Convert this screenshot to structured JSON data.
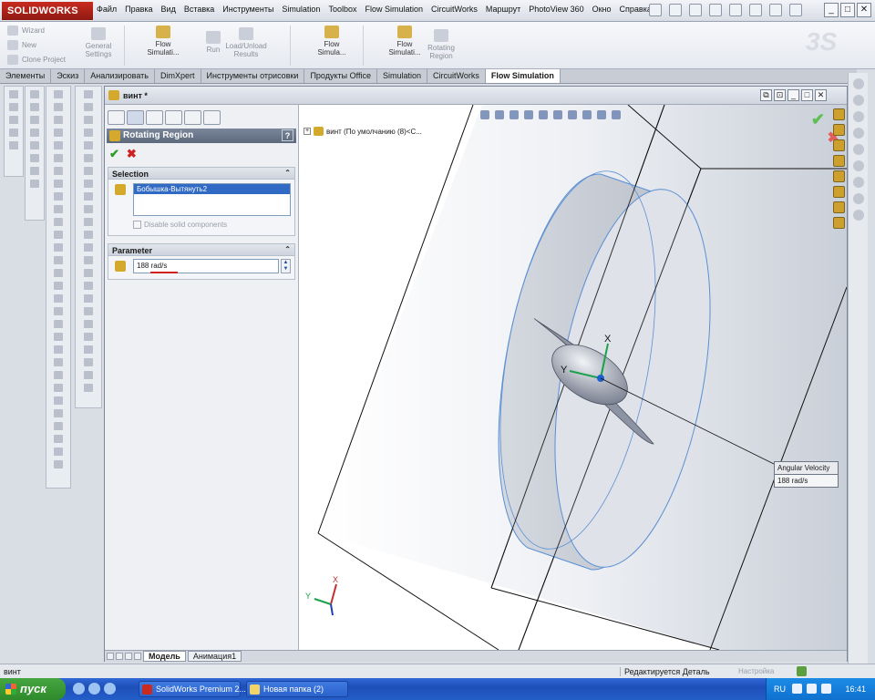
{
  "app": {
    "logo_text": "SOLIDWORKS",
    "menu": [
      "Файл",
      "Правка",
      "Вид",
      "Вставка",
      "Инструменты",
      "Simulation",
      "Toolbox",
      "Flow Simulation",
      "CircuitWorks",
      "Маршрут",
      "PhotoView 360",
      "Окно",
      "Справка"
    ],
    "window_controls": [
      "_",
      "□",
      "✕"
    ]
  },
  "ribbon": {
    "wizard": "Wizard",
    "new": "New",
    "clone_project": "Clone Project",
    "general_settings": "General Settings",
    "flow_sim_1": "Flow Simulati...",
    "run": "Run",
    "load_unload": "Load/Unload Results",
    "flow_sim_2": "Flow Simula...",
    "flow_sim_3": "Flow Simulati...",
    "rotating_region": "Rotating Region"
  },
  "tabs": [
    "Элементы",
    "Эскиз",
    "Анализировать",
    "DimXpert",
    "Инструменты отрисовки",
    "Продукты Office",
    "Simulation",
    "CircuitWorks",
    "Flow Simulation"
  ],
  "active_tab": "Flow Simulation",
  "document": {
    "title": "винт *",
    "controls": [
      "⧉",
      "⊡",
      "_",
      "□",
      "✕"
    ]
  },
  "property_manager": {
    "title": "Rotating Region",
    "help": "?",
    "ok": "✔",
    "cancel": "✖",
    "selection": {
      "header": "Selection",
      "item": "Бобышка-Вытянуть2",
      "disable_solid": "Disable solid components"
    },
    "parameter": {
      "header": "Parameter",
      "value": "188 rad/s",
      "spin_up": "▲",
      "spin_down": "▼"
    },
    "collapse": "⌃"
  },
  "graphics": {
    "tree_node": "винт  (По умолчанию (8)<С...",
    "tree_expand": "+",
    "tooltip_label": "Angular Velocity",
    "tooltip_value": "188 rad/s",
    "ok": "✔",
    "cancel": "✖",
    "axis_x": "X",
    "axis_y": "Y",
    "triad_x": "X",
    "triad_y": "Y"
  },
  "model_tabs": [
    "Модель",
    "Анимация1"
  ],
  "status": {
    "left": "винт",
    "mid": "Редактируется Деталь",
    "right": "Настройка"
  },
  "taskbar": {
    "start": "пуск",
    "btn1": "SolidWorks Premium 2...",
    "btn2": "Новая папка (2)",
    "lang": "RU",
    "clock": "16:41"
  },
  "colors": {
    "accent": "#d5aa2c",
    "pm_header": "#5c687c",
    "selection": "#316ac5",
    "ok": "#2c9b28",
    "cancel": "#cf2020",
    "taskbar": "#245ec8"
  }
}
